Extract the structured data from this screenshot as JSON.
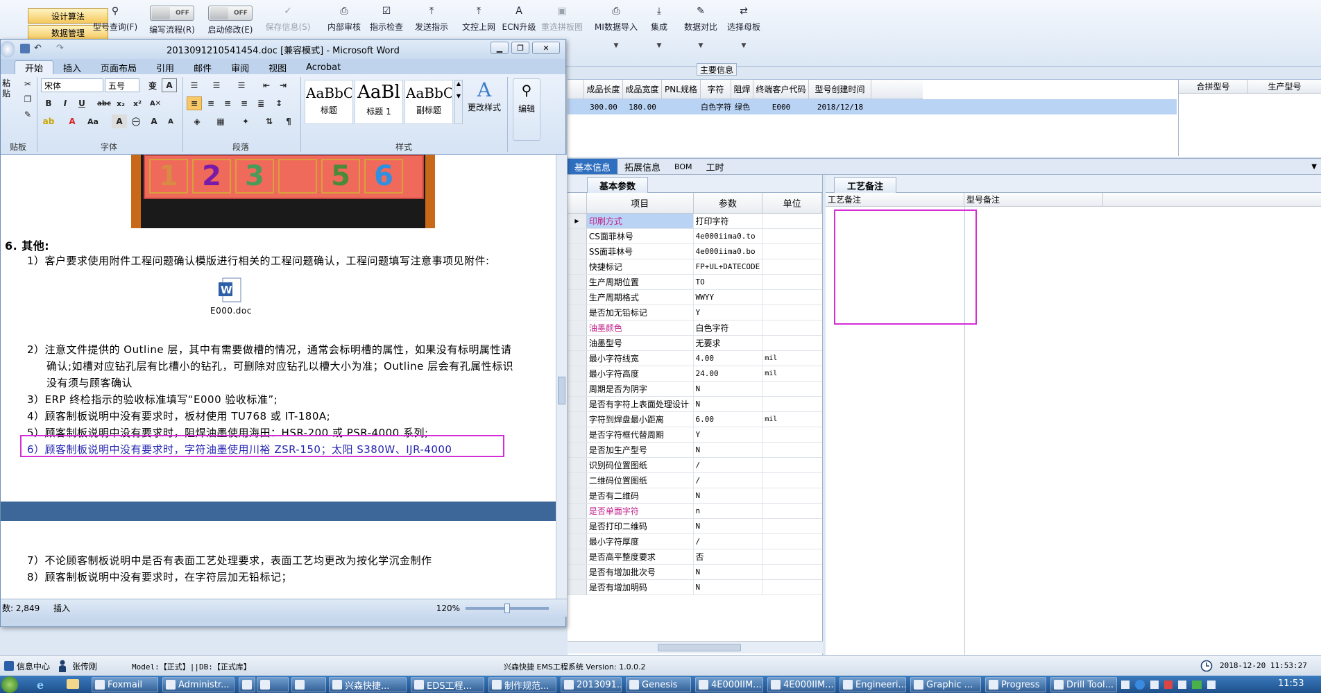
{
  "app": {
    "left_menu": [
      "设计算法",
      "数据管理"
    ],
    "toolbar": [
      {
        "label": "型号查询(F)",
        "icon": "search-icon"
      },
      {
        "label": "编写流程(R)",
        "icon": "toggle-off",
        "toggle": "OFF"
      },
      {
        "label": "启动修改(E)",
        "icon": "toggle-off",
        "toggle": "OFF"
      },
      {
        "label": "保存信息(S)",
        "icon": "check-icon",
        "disabled": true
      },
      {
        "label": "内部审核",
        "icon": "print-icon"
      },
      {
        "label": "指示检查",
        "icon": "check-list-icon"
      },
      {
        "label": "发送指示",
        "icon": "upload-icon"
      },
      {
        "label": "文控上网",
        "icon": "upload-icon"
      },
      {
        "label": "ECN升级",
        "icon": "ecn-icon"
      },
      {
        "label": "重选拼板图",
        "icon": "image-icon",
        "disabled": true
      },
      {
        "label": "MI数据导入",
        "icon": "print-icon"
      },
      {
        "label": "集成",
        "icon": "download-icon"
      },
      {
        "label": "数据对比",
        "icon": "compare-icon"
      },
      {
        "label": "选择母板",
        "icon": "shuffle-icon"
      }
    ],
    "main_info_label": "主要信息",
    "top_grid": {
      "headers": [
        "成品长度",
        "成品宽度",
        "PNL规格",
        "字符",
        "阻焊",
        "终端客户代码",
        "型号创建时间"
      ],
      "row": [
        "300.00",
        "180.00",
        "",
        "白色字符",
        "绿色",
        "E000",
        "2018/12/18"
      ],
      "right_headers": [
        "合拼型号",
        "生产型号"
      ]
    },
    "tabs": [
      "基本信息",
      "拓展信息",
      "BOM",
      "工时"
    ],
    "basic_params": {
      "title": "基本参数",
      "headers": [
        "项目",
        "参数",
        "单位"
      ],
      "rows": [
        {
          "item": "印刷方式",
          "param": "打印字符",
          "unit": "",
          "hl": true
        },
        {
          "item": "CS面菲林号",
          "param": "4e000iima0.to",
          "unit": ""
        },
        {
          "item": "SS面菲林号",
          "param": "4e000iima0.bo",
          "unit": ""
        },
        {
          "item": "快捷标记",
          "param": "FP+UL+DATECODE",
          "unit": ""
        },
        {
          "item": "生产周期位置",
          "param": "TO",
          "unit": ""
        },
        {
          "item": "生产周期格式",
          "param": "WWYY",
          "unit": ""
        },
        {
          "item": "是否加无铅标记",
          "param": "Y",
          "unit": ""
        },
        {
          "item": "油墨颜色",
          "param": "白色字符",
          "unit": "",
          "hl": true
        },
        {
          "item": "油墨型号",
          "param": "无要求",
          "unit": ""
        },
        {
          "item": "最小字符线宽",
          "param": "4.00",
          "unit": "mil"
        },
        {
          "item": "最小字符高度",
          "param": "24.00",
          "unit": "mil"
        },
        {
          "item": "周期是否为阴字",
          "param": "N",
          "unit": ""
        },
        {
          "item": "是否有字符上表面处理设计",
          "param": "N",
          "unit": ""
        },
        {
          "item": "字符到焊盘最小距离",
          "param": "6.00",
          "unit": "mil"
        },
        {
          "item": "是否字符框代替周期",
          "param": "Y",
          "unit": ""
        },
        {
          "item": "是否加生产型号",
          "param": "N",
          "unit": ""
        },
        {
          "item": "识别码位置图纸",
          "param": "/",
          "unit": ""
        },
        {
          "item": "二维码位置图纸",
          "param": "/",
          "unit": ""
        },
        {
          "item": "是否有二维码",
          "param": "N",
          "unit": ""
        },
        {
          "item": "是否单面字符",
          "param": "n",
          "unit": "",
          "hl": true
        },
        {
          "item": "是否打印二维码",
          "param": "N",
          "unit": ""
        },
        {
          "item": "最小字符厚度",
          "param": "/",
          "unit": ""
        },
        {
          "item": "是否高平整度要求",
          "param": "否",
          "unit": ""
        },
        {
          "item": "是否有增加批次号",
          "param": "N",
          "unit": ""
        },
        {
          "item": "是否有增加明码",
          "param": "N",
          "unit": ""
        }
      ]
    },
    "craft_panel": {
      "title": "工艺备注",
      "headers": [
        "工艺备注",
        "型号备注"
      ]
    },
    "status": {
      "info_center": "信息中心",
      "user": "张传刚",
      "model_db": "Model:【正式】||DB:【正式库】",
      "system": "兴森快捷  EMS工程系统  Version: 1.0.0.2",
      "datetime": "2018-12-20 11:53:27"
    }
  },
  "word": {
    "title": "2013091210541454.doc [兼容模式] - Microsoft Word",
    "ribbon_tabs": [
      "开始",
      "插入",
      "页面布局",
      "引用",
      "邮件",
      "审阅",
      "视图",
      "Acrobat"
    ],
    "font_name": "宋体",
    "font_size": "五号",
    "group_labels": [
      "贴板",
      "字体",
      "段落",
      "样式"
    ],
    "styles": [
      {
        "preview": "AaBbC",
        "name": "标题"
      },
      {
        "preview": "AaBl",
        "name": "标题 1"
      },
      {
        "preview": "AaBbC",
        "name": "副标题"
      }
    ],
    "change_styles": "更改样式",
    "edit": "编辑",
    "paste": "粘贴",
    "doc": {
      "pcb_digits": [
        "1",
        "2",
        "3",
        "",
        "5",
        "6"
      ],
      "heading": "6.  其他:",
      "items": [
        "1）客户要求使用附件工程问题确认模版进行相关的工程问题确认，工程问题填写注意事项见附件:",
        "2）注意文件提供的 Outline 层，其中有需要做槽的情况，通常会标明槽的属性，如果没有标明属性请",
        "确认;如槽对应钻孔层有比槽小的钻孔，可删除对应钻孔以槽大小为准；Outline 层会有孔属性标识",
        "没有须与顾客确认",
        "3）ERP 终检指示的验收标准填写“E000 验收标准”;",
        "4）顾客制板说明中没有要求时，板材使用 TU768 或 IT-180A;",
        "5）顾客制板说明中没有要求时，阻焊油墨使用海田：HSR-200 或 PSR-4000 系列;",
        "6）顾客制板说明中没有要求时，字符油墨使用川裕 ZSR-150；太阳 S380W、IJR-4000",
        "7）不论顾客制板说明中是否有表面工艺处理要求，表面工艺均更改为按化学沉金制作",
        "8）顾客制板说明中没有要求时，在字符层加无铅标记；"
      ],
      "attachment": "E000.doc"
    },
    "status": {
      "words": "数: 2,849",
      "mode": "插入",
      "zoom": "120%"
    }
  },
  "taskbar": {
    "tasks": [
      "Foxmail",
      "Administr...",
      "",
      "",
      "",
      "兴森快捷...",
      "EDS工程...",
      "制作规范...",
      "2013091...",
      "Genesis",
      "4E000IIM...",
      "4E000IIM...",
      "Engineeri...",
      "Graphic ...",
      "Progress",
      "Drill Tool..."
    ],
    "clock": "11:53"
  }
}
